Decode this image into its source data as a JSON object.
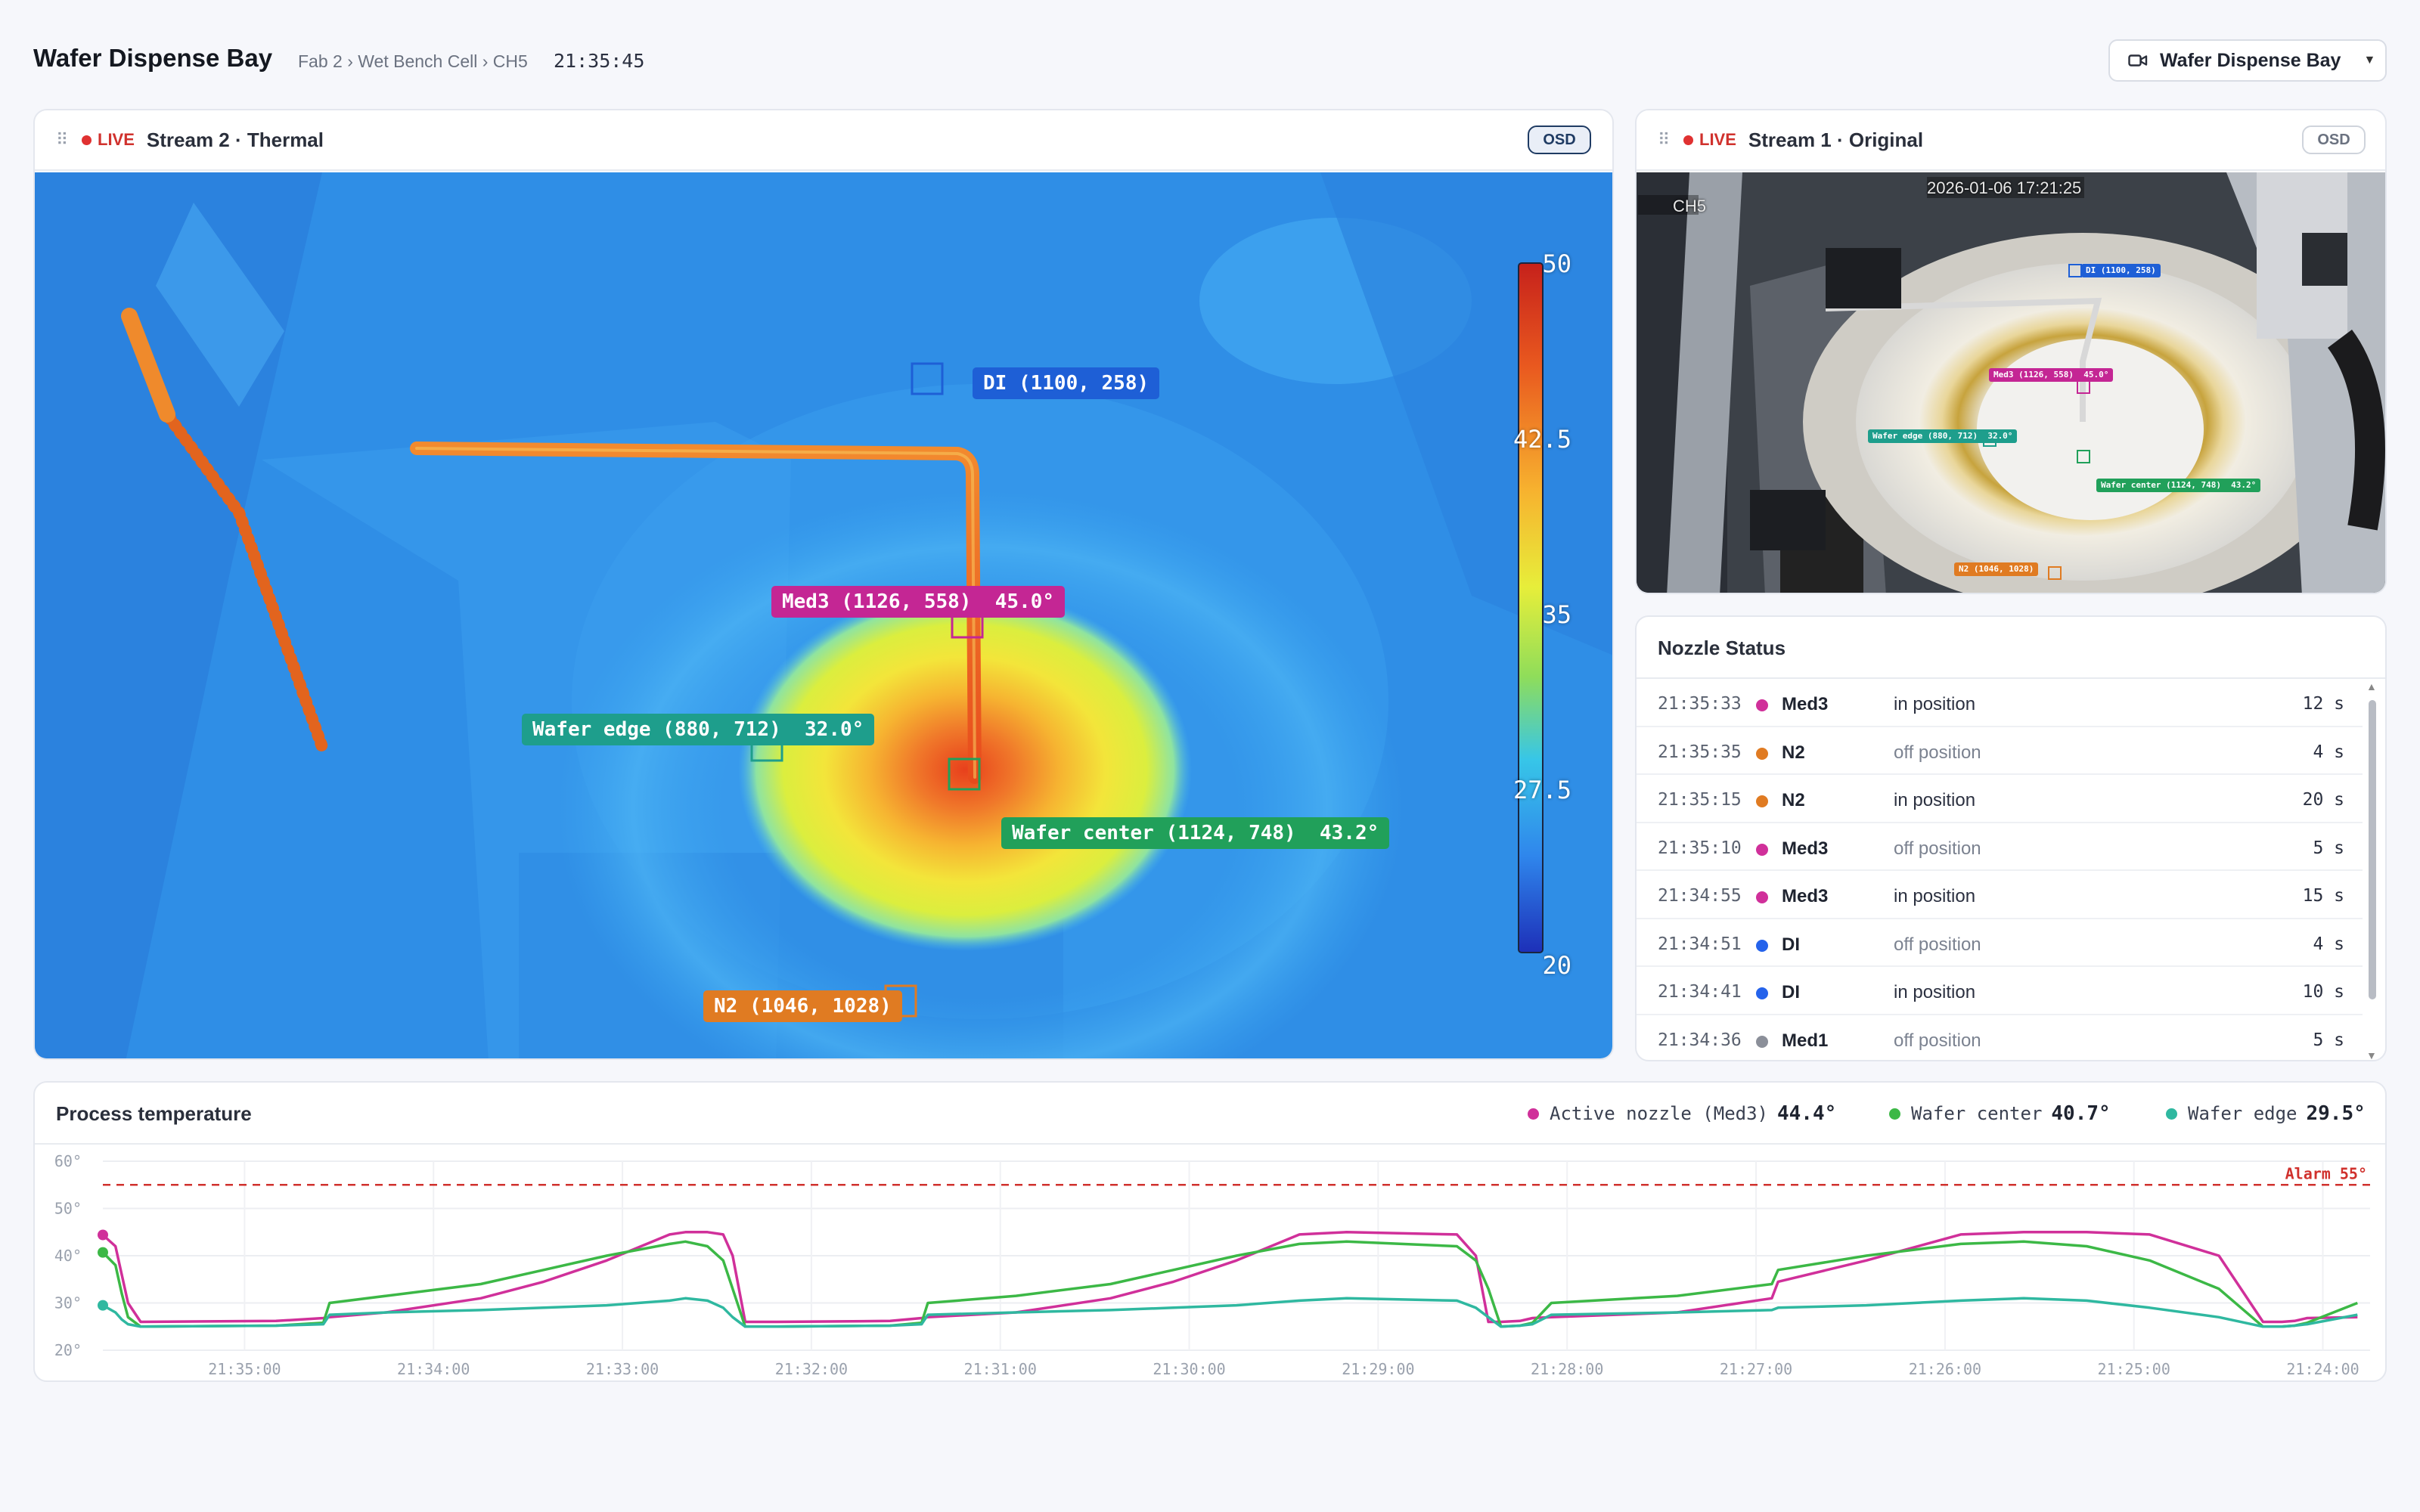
{
  "header": {
    "title": "Wafer Dispense Bay",
    "breadcrumb": "Fab 2 › Wet Bench Cell › CH5",
    "clock": "21:35:45",
    "camera_select": "Wafer Dispense Bay"
  },
  "thermal": {
    "live": "LIVE",
    "title": "Stream 2 · Thermal",
    "osd": "OSD",
    "scale": [
      "50",
      "42.5",
      "35",
      "27.5",
      "20"
    ],
    "tags": {
      "di": "DI (1100, 258)",
      "med3": "Med3 (1126, 558)  45.0°",
      "wafer_edge": "Wafer edge (880, 712)  32.0°",
      "wafer_center": "Wafer center (1124, 748)  43.2°",
      "n2": "N2 (1046, 1028)"
    },
    "colors": {
      "di": "#1e5fd6",
      "med3": "#c42694",
      "wafer_edge": "#1e9e8c",
      "wafer_center": "#21a05a",
      "n2": "#e07b22"
    }
  },
  "original": {
    "live": "LIVE",
    "title": "Stream 1 · Original",
    "osd": "OSD",
    "channel": "CH5",
    "timestamp": "2026-01-06 17:21:25",
    "tags": {
      "di": "DI (1100, 258)",
      "med3": "Med3 (1126, 558)  45.0°",
      "wafer_edge": "Wafer edge (880, 712)  32.0°",
      "wafer_center": "Wafer center (1124, 748)  43.2°",
      "n2": "N2 (1046, 1028)"
    }
  },
  "nozzle_status": {
    "title": "Nozzle Status",
    "rows": [
      {
        "time": "21:35:33",
        "name": "Med3",
        "state": "in position",
        "duration": "12 s",
        "color": "#d0309a",
        "active": true
      },
      {
        "time": "21:35:35",
        "name": "N2",
        "state": "off position",
        "duration": "4 s",
        "color": "#e07b22",
        "active": false
      },
      {
        "time": "21:35:15",
        "name": "N2",
        "state": "in position",
        "duration": "20 s",
        "color": "#e07b22",
        "active": true
      },
      {
        "time": "21:35:10",
        "name": "Med3",
        "state": "off position",
        "duration": "5 s",
        "color": "#d0309a",
        "active": false
      },
      {
        "time": "21:34:55",
        "name": "Med3",
        "state": "in position",
        "duration": "15 s",
        "color": "#d0309a",
        "active": true
      },
      {
        "time": "21:34:51",
        "name": "DI",
        "state": "off position",
        "duration": "4 s",
        "color": "#2563eb",
        "active": false
      },
      {
        "time": "21:34:41",
        "name": "DI",
        "state": "in position",
        "duration": "10 s",
        "color": "#2563eb",
        "active": true
      },
      {
        "time": "21:34:36",
        "name": "Med1",
        "state": "off position",
        "duration": "5 s",
        "color": "#8b8f99",
        "active": false
      }
    ]
  },
  "process_temperature": {
    "title": "Process temperature",
    "legend": [
      {
        "label": "Active nozzle (Med3)",
        "value": "44.4°",
        "color": "#d0309a"
      },
      {
        "label": "Wafer center",
        "value": "40.7°",
        "color": "#3cb846"
      },
      {
        "label": "Wafer edge",
        "value": "29.5°",
        "color": "#2fb8a0"
      }
    ]
  },
  "chart_data": {
    "type": "line",
    "title": "Process temperature",
    "y_tick_labels": [
      "60°",
      "50°",
      "40°",
      "30°",
      "20°"
    ],
    "ylim": [
      20,
      60
    ],
    "x_tick_labels": [
      "21:35:00",
      "21:34:00",
      "21:33:00",
      "21:32:00",
      "21:31:00",
      "21:30:00",
      "21:29:00",
      "21:28:00",
      "21:27:00",
      "21:26:00",
      "21:25:00",
      "21:24:00"
    ],
    "x_axis_note": "time runs backwards left to right: newest sample at left",
    "alarm": {
      "label": "Alarm 55°",
      "value": 55,
      "color": "#d0312d"
    },
    "x_seconds_ago": [
      0,
      4,
      6,
      8,
      12,
      55,
      70,
      72,
      90,
      120,
      140,
      160,
      180,
      185,
      192,
      197,
      200,
      204,
      214,
      250,
      260,
      262,
      290,
      320,
      340,
      360,
      380,
      395,
      430,
      436,
      440,
      444,
      450,
      454,
      460,
      500,
      530,
      532,
      560,
      590,
      610,
      630,
      650,
      672,
      686,
      692,
      696,
      700,
      716
    ],
    "series": [
      {
        "name": "Active nozzle (Med3)",
        "color": "#d0309a",
        "values": [
          44.4,
          42,
          36,
          30,
          26,
          26.2,
          26.8,
          27,
          28,
          31,
          34.5,
          39,
          44.5,
          45,
          45,
          44.5,
          40,
          26,
          26,
          26.2,
          26.8,
          27,
          28,
          31,
          34.5,
          39,
          44.5,
          45,
          44.5,
          40,
          26,
          26,
          26.2,
          26.8,
          27,
          28,
          31,
          34.5,
          39,
          44.5,
          45,
          45,
          44.5,
          40,
          26,
          26,
          26.2,
          26.8,
          27
        ]
      },
      {
        "name": "Wafer center",
        "color": "#3cb846",
        "values": [
          40.7,
          38,
          32,
          27,
          25,
          25.2,
          25.8,
          30,
          31.5,
          34,
          37,
          40,
          42.5,
          43,
          42,
          39,
          33,
          25,
          25,
          25.2,
          25.8,
          30,
          31.5,
          34,
          37,
          40,
          42.5,
          43,
          42,
          39,
          33,
          25,
          25.2,
          25.8,
          30,
          31.5,
          34,
          37,
          40,
          42.5,
          43,
          42,
          39,
          33,
          25,
          25,
          25.2,
          25.8,
          30
        ]
      },
      {
        "name": "Wafer edge",
        "color": "#2fb8a0",
        "values": [
          29.5,
          28,
          26.5,
          25.5,
          25,
          25.2,
          25.5,
          27.5,
          28,
          28.5,
          29,
          29.5,
          30.5,
          31,
          30.5,
          29,
          27,
          25,
          25,
          25.2,
          25.5,
          27.5,
          28,
          28.5,
          29,
          29.5,
          30.5,
          31,
          30.5,
          29,
          27,
          25,
          25.2,
          25.5,
          27.5,
          28,
          28.5,
          29,
          29.5,
          30.5,
          31,
          30.5,
          29,
          27,
          25,
          25,
          25.2,
          25.5,
          27.5
        ]
      }
    ]
  }
}
